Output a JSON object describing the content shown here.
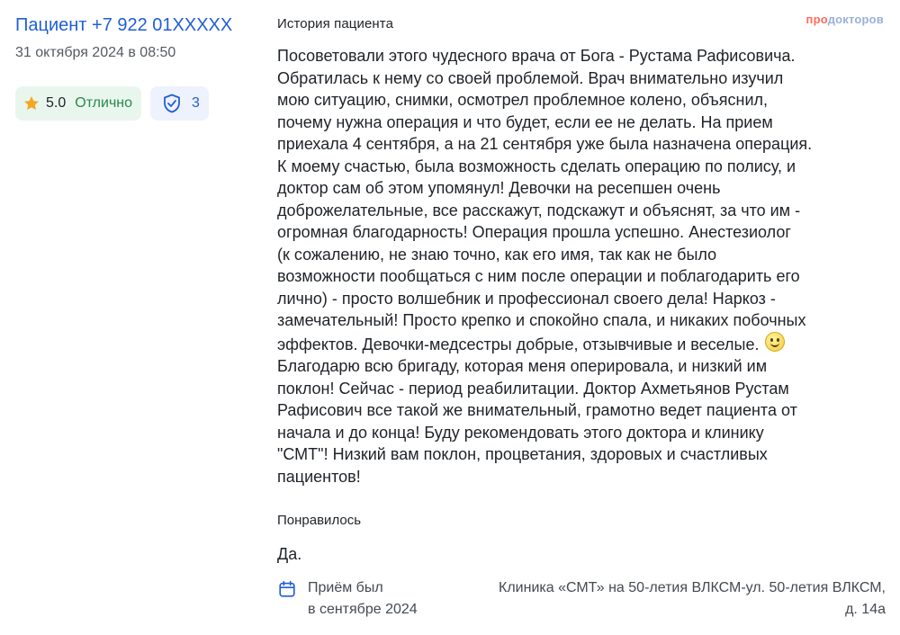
{
  "author": {
    "name": "Пациент +7 922 01XXXXX",
    "date": "31 октября 2024 в 08:50"
  },
  "rating": {
    "value": "5.0",
    "label": "Отлично",
    "star_color": "#f5a623"
  },
  "verified": {
    "icon": "shield-check-icon",
    "count": "3"
  },
  "logo": {
    "pro": "про",
    "rest": "докторов"
  },
  "story": {
    "title": "История пациента",
    "text_part1": "Посоветовали этого чудесного врача от Бога - Рустама Рафисовича.\nОбратилась к нему со своей проблемой. Врач внимательно изучил\nмою ситуацию, снимки, осмотрел проблемное колено, объяснил,\nпочему нужна операция и что будет, если ее не делать. На прием\nприехала 4 сентября, а на 21 сентября уже была назначена операция.\nК моему счастью, была возможность сделать операцию по полису, и\nдоктор сам об этом упомянул! Девочки на ресепшен очень\nдоброжелательные, все расскажут, подскажут и объяснят, за что им -\nогромная благодарность! Операция прошла успешно. Анестезиолог\n(к сожалению, не знаю точно, как его имя, так как не было\nвозможности пообщаться с ним после операции и поблагодарить его\nлично) - просто волшебник и профессионал своего дела! Наркоз -\nзамечательный! Просто крепко и спокойно спала, и никаких побочных\nэффектов. Девочки-медсестры добрые, отзывчивые и веселые.",
    "emoji": "smile-emoji",
    "text_part2": "\nБлагодарю всю бригаду, которая меня оперировала, и низкий им\nпоклон! Сейчас - период реабилитации. Доктор Ахметьянов Рустам\nРафисович все такой же внимательный, грамотно ведет пациента от\nначала и до конца! Буду рекомендовать этого доктора и клинику\n\"СМТ\"! Низкий вам поклон, процветания, здоровых и счастливых\nпациентов!"
  },
  "liked": {
    "title": "Понравилось",
    "text": "Да."
  },
  "visit": {
    "icon": "calendar-icon",
    "line1": "Приём был",
    "line2": "в сентябре 2024"
  },
  "clinic": {
    "address": "Клиника «СМТ» на 50-летия ВЛКСМ-ул. 50-летия ВЛКСМ, д. 14а"
  }
}
